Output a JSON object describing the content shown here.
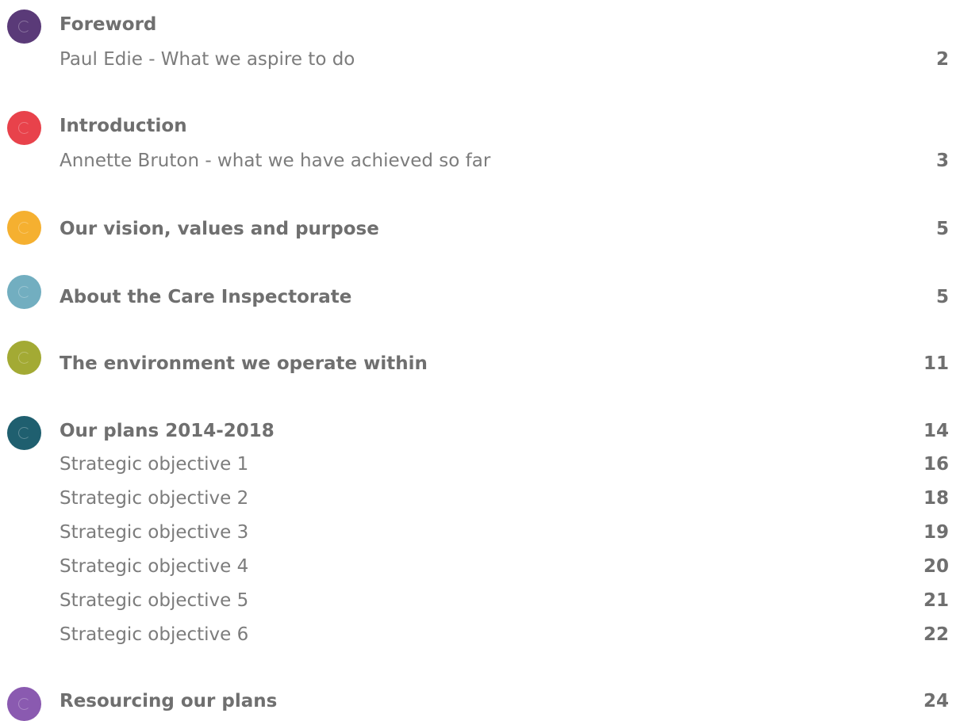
{
  "sections": [
    {
      "id": "foreword",
      "title": "Foreword",
      "subtitle": "Paul Edie - What we aspire to do",
      "page": "2",
      "color": "#5a3a78"
    },
    {
      "id": "introduction",
      "title": "Introduction",
      "subtitle": "Annette Bruton - what we have achieved so far",
      "page": "3",
      "color": "#e8424b"
    },
    {
      "id": "vision",
      "title": "Our vision, values and purpose",
      "page": "5",
      "color": "#f5b030"
    },
    {
      "id": "about",
      "title": "About the Care Inspectorate",
      "page": "5",
      "color": "#72aec0"
    },
    {
      "id": "environment",
      "title": "The environment we operate within",
      "page": "11",
      "color": "#a3aa34"
    },
    {
      "id": "plans",
      "title": "Our plans 2014-2018",
      "page": "14",
      "color": "#1f5f6f",
      "items": [
        {
          "label": "Strategic objective 1",
          "page": "16"
        },
        {
          "label": "Strategic objective 2",
          "page": "18"
        },
        {
          "label": "Strategic objective 3",
          "page": "19"
        },
        {
          "label": "Strategic objective 4",
          "page": "20"
        },
        {
          "label": "Strategic objective 5",
          "page": "21"
        },
        {
          "label": "Strategic objective 6",
          "page": "22"
        }
      ]
    },
    {
      "id": "resourcing",
      "title": "Resourcing our plans",
      "page": "24",
      "color": "#8a5ab0"
    }
  ]
}
